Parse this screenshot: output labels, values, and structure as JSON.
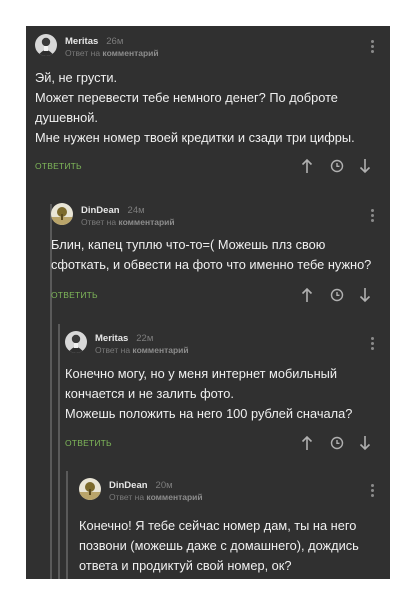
{
  "comments": [
    {
      "author": "Meritas",
      "time": "26м",
      "reply_prefix": "Ответ на",
      "reply_target": "комментарий",
      "lines": [
        "Эй, не грусти.",
        "Может перевести тебе немного денег? По доброте",
        "душевной.",
        "Мне нужен номер твоей кредитки и сзади три цифры."
      ],
      "reply_label": "ОТВЕТИТЬ",
      "avatar": "meritas-avatar"
    },
    {
      "author": "DinDean",
      "time": "24м",
      "reply_prefix": "Ответ на",
      "reply_target": "комментарий",
      "lines": [
        "Блин, капец туплю что-то=( Можешь плз свою",
        "сфоткать, и обвести на фото что именно тебе нужно?"
      ],
      "reply_label": "ОТВЕТИТЬ",
      "avatar": "dindean-avatar"
    },
    {
      "author": "Meritas",
      "time": "22м",
      "reply_prefix": "Ответ на",
      "reply_target": "комментарий",
      "lines": [
        "Конечно могу, но у меня интернет мобильный",
        "кончается и не залить фото.",
        "Можешь положить на него 100 рублей сначала?"
      ],
      "reply_label": "ОТВЕТИТЬ",
      "avatar": "meritas-avatar"
    },
    {
      "author": "DinDean",
      "time": "20м",
      "reply_prefix": "Ответ на",
      "reply_target": "комментарий",
      "lines": [
        "Конечно! Я тебе сейчас номер дам, ты на него",
        "позвони (можешь даже с домашнего), дождись",
        "ответа и продиктуй свой номер, ок?"
      ],
      "reply_label": "",
      "avatar": "dindean-avatar"
    }
  ],
  "icons": {
    "upvote": "arrow-up-icon",
    "time": "clock-icon",
    "downvote": "arrow-down-icon",
    "menu": "more-vertical-icon"
  },
  "colors": {
    "background": "#303030",
    "text": "#f0f0f0",
    "reply_button": "#7fb85a",
    "muted": "#7a7a7a"
  }
}
